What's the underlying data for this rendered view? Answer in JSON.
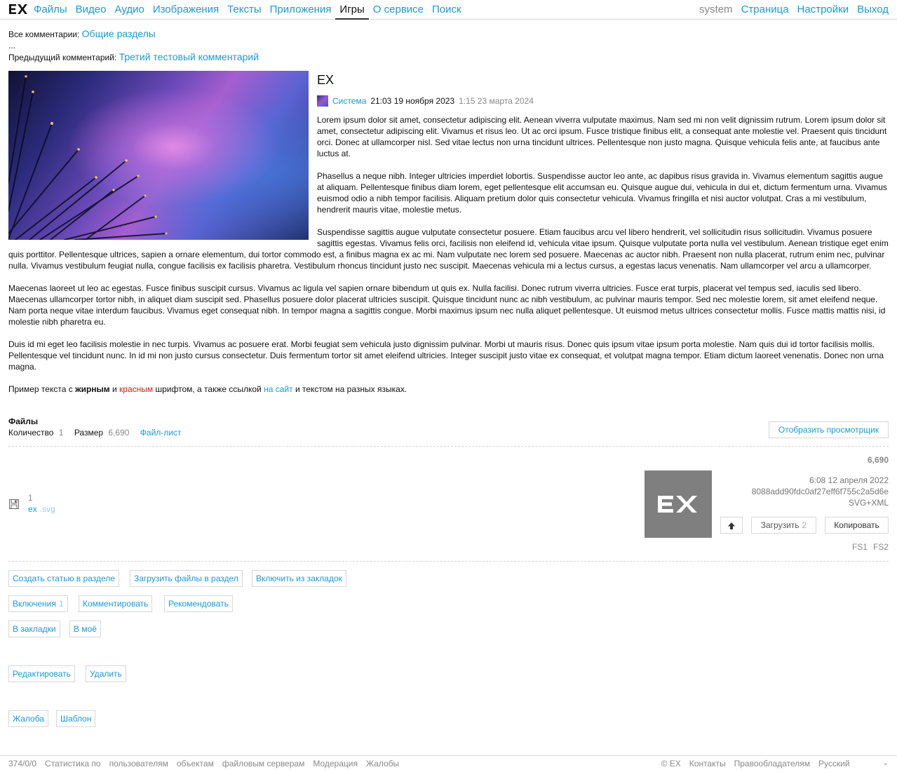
{
  "nav": {
    "logo": "EX",
    "items": [
      "Файлы",
      "Видео",
      "Аудио",
      "Изображения",
      "Тексты",
      "Приложения",
      "Игры",
      "О сервисе",
      "Поиск"
    ],
    "active": "Игры",
    "right": {
      "user": "system",
      "page": "Страница",
      "settings": "Настройки",
      "logout": "Выход"
    }
  },
  "crumbs": {
    "all_label": "Все комментарии:",
    "all_link": "Общие разделы",
    "ellipsis": "...",
    "prev_label": "Предыдущий комментарий:",
    "prev_link": "Третий тестовый комментарий"
  },
  "article": {
    "title": "EX",
    "author": "Система",
    "created": "21:03 19 ноября 2023",
    "updated": "1:15 23 марта 2024",
    "paragraphs": [
      "Lorem ipsum dolor sit amet, consectetur adipiscing elit. Aenean viverra vulputate maximus. Nam sed mi non velit dignissim rutrum. Lorem ipsum dolor sit amet, consectetur adipiscing elit. Vivamus et risus leo. Ut ac orci ipsum. Fusce tristique finibus elit, a consequat ante molestie vel. Praesent quis tincidunt orci. Donec at ullamcorper nisl. Sed vitae lectus non urna tincidunt ultrices. Pellentesque non justo magna. Quisque vehicula felis ante, at faucibus ante luctus at.",
      "Phasellus a neque nibh. Integer ultricies imperdiet lobortis. Suspendisse auctor leo ante, ac dapibus risus gravida in. Vivamus elementum sagittis augue at aliquam. Pellentesque finibus diam lorem, eget pellentesque elit accumsan eu. Quisque augue dui, vehicula in dui et, dictum fermentum urna. Vivamus euismod odio a nibh tempor facilisis. Aliquam pretium dolor quis consectetur vehicula. Vivamus fringilla et nisi auctor volutpat. Cras a mi vestibulum, hendrerit mauris vitae, molestie metus.",
      "Suspendisse sagittis augue vulputate consectetur posuere. Etiam faucibus arcu vel libero hendrerit, vel sollicitudin risus sollicitudin. Vivamus posuere sagittis egestas. Vivamus felis orci, facilisis non eleifend id, vehicula vitae ipsum. Quisque vulputate porta nulla vel vestibulum. Aenean tristique eget enim quis porttitor. Pellentesque ultrices, sapien a ornare elementum, dui tortor commodo est, a finibus magna ex ac mi. Nam vulputate nec lorem sed posuere. Maecenas ac auctor nibh. Praesent non nulla placerat, rutrum enim nec, pulvinar nulla. Vivamus vestibulum feugiat nulla, congue facilisis ex facilisis pharetra. Vestibulum rhoncus tincidunt justo nec suscipit. Maecenas vehicula mi a lectus cursus, a egestas lacus venenatis. Nam ullamcorper vel arcu a ullamcorper.",
      "Maecenas laoreet ut leo ac egestas. Fusce finibus suscipit cursus. Vivamus ac ligula vel sapien ornare bibendum ut quis ex. Nulla facilisi. Donec rutrum viverra ultricies. Fusce erat turpis, placerat vel tempus sed, iaculis sed libero. Maecenas ullamcorper tortor nibh, in aliquet diam suscipit sed. Phasellus posuere dolor placerat ultricies suscipit. Quisque tincidunt nunc ac nibh vestibulum, ac pulvinar mauris tempor. Sed nec molestie lorem, sit amet eleifend neque. Nam porta neque vitae interdum faucibus. Vivamus eget consequat nibh. In tempor magna a sagittis congue. Morbi maximus ipsum nec nulla aliquet pellentesque. Ut euismod metus ultrices consectetur mollis. Fusce mattis mattis nisi, id molestie nibh pharetra eu.",
      "Duis id mi eget leo facilisis molestie in nec turpis. Vivamus ac posuere erat. Morbi feugiat sem vehicula justo dignissim pulvinar. Morbi ut mauris risus. Donec quis ipsum vitae ipsum porta molestie. Nam quis dui id tortor facilisis mollis. Pellentesque vel tincidunt nunc. In id mi non justo cursus consectetur. Duis fermentum tortor sit amet eleifend ultricies. Integer suscipit justo vitae ex consequat, et volutpat magna tempor. Etiam dictum laoreet venenatis. Donec non urna magna."
    ],
    "sample": {
      "t1": "Пример текста с ",
      "bold": "жирным",
      "t2": " и ",
      "red": "красным",
      "t3": " шрифтом, а также ссылкой ",
      "link": "на сайт",
      "t4": " и текстом на разных языках."
    }
  },
  "files": {
    "title": "Файлы",
    "count_label": "Количество",
    "count": "1",
    "size_label": "Размер",
    "size": "6,690",
    "list_link": "Файл-лист",
    "viewer_button": "Отобразить просмотрщик",
    "file": {
      "size": "6,690",
      "number": "1",
      "name": "ex",
      "ext": ".svg",
      "thumb_text": "EX",
      "date": "6:08 12 апреля 2022",
      "hash": "8088add90fdc0af27eff6f755c2a5d6e",
      "mime": "SVG+XML",
      "upload_label": "Загрузить",
      "upload_count": "2",
      "copy_label": "Копировать",
      "fs1": "FS1",
      "fs2": "FS2"
    }
  },
  "actions": {
    "create_article": "Создать статью в разделе",
    "upload_files": "Загрузить файлы в раздел",
    "include_bookmarks": "Включить из закладок",
    "inclusions": "Включения",
    "inclusions_count": "1",
    "comment": "Комментировать",
    "recommend": "Рекомендовать",
    "to_bookmarks": "В закладки",
    "to_mine": "В моё",
    "edit": "Редактировать",
    "delete": "Удалить",
    "complaint": "Жалоба",
    "template": "Шаблон"
  },
  "footer": {
    "counter": "374/0/0",
    "stats": "Статистика по",
    "users": "пользователям",
    "objects": "объектам",
    "servers": "файловым серверам",
    "moderation": "Модерация",
    "complaints": "Жалобы",
    "copyright": "© EX",
    "contacts": "Контакты",
    "rightholders": "Правообладателям",
    "language": "Русский"
  }
}
